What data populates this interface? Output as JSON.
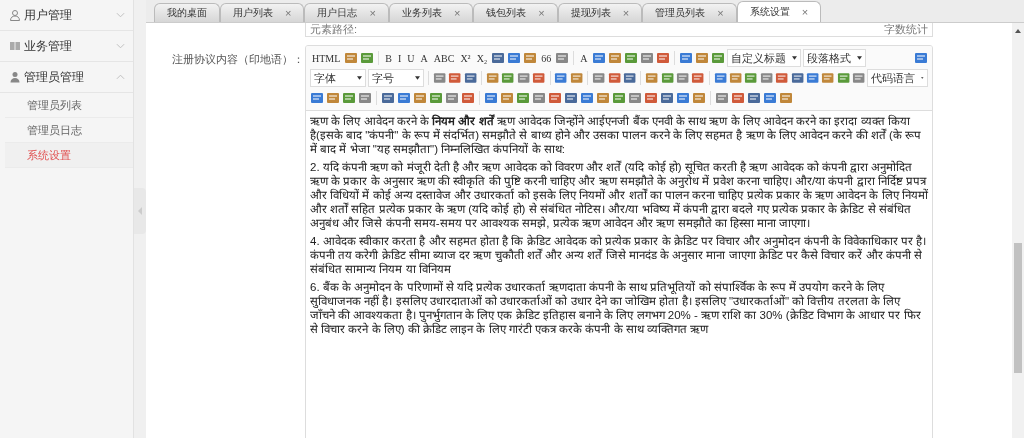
{
  "sidebar": {
    "groups": [
      {
        "label": "用户管理",
        "expanded": false
      },
      {
        "label": "业务管理",
        "expanded": false
      },
      {
        "label": "管理员管理",
        "expanded": true,
        "children": [
          {
            "label": "管理员列表",
            "selected": false
          },
          {
            "label": "管理员日志",
            "selected": false
          },
          {
            "label": "系统设置",
            "selected": true
          }
        ]
      }
    ]
  },
  "tabs": [
    {
      "label": "我的桌面",
      "selected": false,
      "closable": false
    },
    {
      "label": "用户列表",
      "selected": false,
      "closable": true
    },
    {
      "label": "用户日志",
      "selected": false,
      "closable": true
    },
    {
      "label": "业务列表",
      "selected": false,
      "closable": true
    },
    {
      "label": "钱包列表",
      "selected": false,
      "closable": true
    },
    {
      "label": "提现列表",
      "selected": false,
      "closable": true
    },
    {
      "label": "管理员列表",
      "selected": false,
      "closable": true
    },
    {
      "label": "系统设置",
      "selected": true,
      "closable": true
    }
  ],
  "close_glyph": "×",
  "previous_editor": {
    "element_path": "元素路径:",
    "word_count": "字数统计"
  },
  "field_label": "注册协议内容（印地语）：",
  "editor": {
    "toolbar_rows": [
      [
        {
          "kind": "text",
          "label": "HTML"
        },
        {
          "kind": "icon"
        },
        {
          "kind": "icon"
        },
        {
          "kind": "sep"
        },
        {
          "kind": "text",
          "label": "B"
        },
        {
          "kind": "text",
          "label": "I"
        },
        {
          "kind": "text",
          "label": "U"
        },
        {
          "kind": "text",
          "label": "A"
        },
        {
          "kind": "text",
          "label": "ABC"
        },
        {
          "kind": "text",
          "label": "X²"
        },
        {
          "kind": "text",
          "label": "X₂"
        },
        {
          "kind": "icon"
        },
        {
          "kind": "icon"
        },
        {
          "kind": "icon"
        },
        {
          "kind": "text",
          "label": "66"
        },
        {
          "kind": "icon"
        },
        {
          "kind": "sep"
        },
        {
          "kind": "text",
          "label": "A"
        },
        {
          "kind": "icon"
        },
        {
          "kind": "icon"
        },
        {
          "kind": "icon"
        },
        {
          "kind": "icon"
        },
        {
          "kind": "icon"
        },
        {
          "kind": "sep"
        },
        {
          "kind": "icon"
        },
        {
          "kind": "icon"
        },
        {
          "kind": "icon"
        },
        {
          "kind": "select",
          "label": "自定义标题"
        },
        {
          "kind": "select",
          "label": "段落格式"
        },
        {
          "kind": "spacer"
        },
        {
          "kind": "icon"
        }
      ],
      [
        {
          "kind": "select",
          "label": "字体"
        },
        {
          "kind": "select",
          "label": "字号"
        },
        {
          "kind": "sep"
        },
        {
          "kind": "icon"
        },
        {
          "kind": "icon"
        },
        {
          "kind": "icon"
        },
        {
          "kind": "sep"
        },
        {
          "kind": "icon"
        },
        {
          "kind": "icon"
        },
        {
          "kind": "icon"
        },
        {
          "kind": "icon"
        },
        {
          "kind": "sep"
        },
        {
          "kind": "icon"
        },
        {
          "kind": "icon"
        },
        {
          "kind": "sep"
        },
        {
          "kind": "icon"
        },
        {
          "kind": "icon"
        },
        {
          "kind": "icon"
        },
        {
          "kind": "sep"
        },
        {
          "kind": "icon"
        },
        {
          "kind": "icon"
        },
        {
          "kind": "icon"
        },
        {
          "kind": "icon"
        },
        {
          "kind": "sep"
        },
        {
          "kind": "icon"
        },
        {
          "kind": "icon"
        },
        {
          "kind": "icon"
        },
        {
          "kind": "icon"
        },
        {
          "kind": "icon"
        },
        {
          "kind": "icon"
        },
        {
          "kind": "icon"
        },
        {
          "kind": "icon"
        },
        {
          "kind": "icon"
        },
        {
          "kind": "icon"
        },
        {
          "kind": "select",
          "label": "代码语言"
        }
      ],
      [
        {
          "kind": "icon"
        },
        {
          "kind": "icon"
        },
        {
          "kind": "icon"
        },
        {
          "kind": "icon"
        },
        {
          "kind": "sep"
        },
        {
          "kind": "icon"
        },
        {
          "kind": "icon"
        },
        {
          "kind": "icon"
        },
        {
          "kind": "icon"
        },
        {
          "kind": "icon"
        },
        {
          "kind": "icon"
        },
        {
          "kind": "sep"
        },
        {
          "kind": "icon"
        },
        {
          "kind": "icon"
        },
        {
          "kind": "icon"
        },
        {
          "kind": "icon"
        },
        {
          "kind": "icon"
        },
        {
          "kind": "icon"
        },
        {
          "kind": "icon"
        },
        {
          "kind": "icon"
        },
        {
          "kind": "icon"
        },
        {
          "kind": "icon"
        },
        {
          "kind": "icon"
        },
        {
          "kind": "icon"
        },
        {
          "kind": "icon"
        },
        {
          "kind": "icon"
        },
        {
          "kind": "sep"
        },
        {
          "kind": "icon"
        },
        {
          "kind": "icon"
        },
        {
          "kind": "icon"
        },
        {
          "kind": "icon"
        },
        {
          "kind": "icon"
        }
      ]
    ],
    "paragraphs": [
      "ऋण के लिए आवेदन करने के **नियम और शर्तें** ऋण आवेदक जिन्होंने आईएनजी बैंक एनवी के साथ ऋण के लिए आवेदन करने का इरादा व्यक्त किया है(इसके बाद \"कंपनी\" के रूप में संदर्भित) समझौते से बाध्य होने और उसका पालन करने के लिए सहमत है ऋण के लिए आवेदन करने की शर्तें (के रूप में बाद में भेजा \"यह समझौता\") निम्नलिखित कंपनियों के साथ:",
      "2. यदि कंपनी ऋण को मंजूरी देती है और ऋण आवेदक को विवरण और शर्तें (यदि कोई हो) सूचित करती है ऋण आवेदक को कंपनी द्वारा अनुमोदित ऋण के प्रकार के अनुसार ऋण की स्वीकृति की पुष्टि करनी चाहिए और ऋण समझौते के अनुरोध में प्रवेश करना चाहिए। और/या कंपनी द्वारा निर्दिष्ट प्रपत्र और विधियों में कोई अन्य दस्तावेज और उधारकर्ता को इसके लिए नियमों और शर्तों का पालन करना चाहिए प्रत्येक प्रकार के ऋण आवेदन के लिए नियमों और शर्तों सहित प्रत्येक प्रकार के ऋण (यदि कोई हो) से संबंधित नोटिस। और/या भविष्य में कंपनी द्वारा बदले गए प्रत्येक प्रकार के क्रेडिट से संबंधित अनुबंध और जिसे कंपनी समय-समय पर आवश्यक समझे, प्रत्येक ऋण आवेदन और ऋण समझौते का हिस्सा माना जाएगा।",
      "4. आवेदक स्वीकार करता है और सहमत होता है कि क्रेडिट आवेदक को प्रत्येक प्रकार के क्रेडिट पर विचार और अनुमोदन कंपनी के विवेकाधिकार पर है। कंपनी तय करेगी क्रेडिट सीमा ब्याज दर ऋण चुकौती शर्तें और अन्य शर्तें जिसे मानदंड के अनुसार माना जाएगा क्रेडिट पर कैसे विचार करें और कंपनी से संबंधित सामान्य नियम या विनियम",
      "6. बैंक के अनुमोदन के परिणामों से यदि प्रत्येक उधारकर्ता ऋणदाता कंपनी के साथ प्रतिभूतियों को संपार्श्विक के रूप में उपयोग करने के लिए सुविधाजनक नहीं है। इसलिए उधारदाताओं को उधारकर्ताओं को उधार देने का जोखिम होता है। इसलिए \"उधारकर्ताओं\" को वित्तीय तरलता के लिए जाँचने की आवश्यकता है। पुनर्भुगतान के लिए एक क्रेडिट इतिहास बनाने के लिए लगभग 20% - ऋण राशि का 30% (क्रेडिट विभाग के आधार पर फिर से विचार करने के लिए) की क्रेडिट लाइन के लिए गारंटी एकत्र करके कंपनी के साथ व्यक्तिगत ऋण"
    ]
  }
}
